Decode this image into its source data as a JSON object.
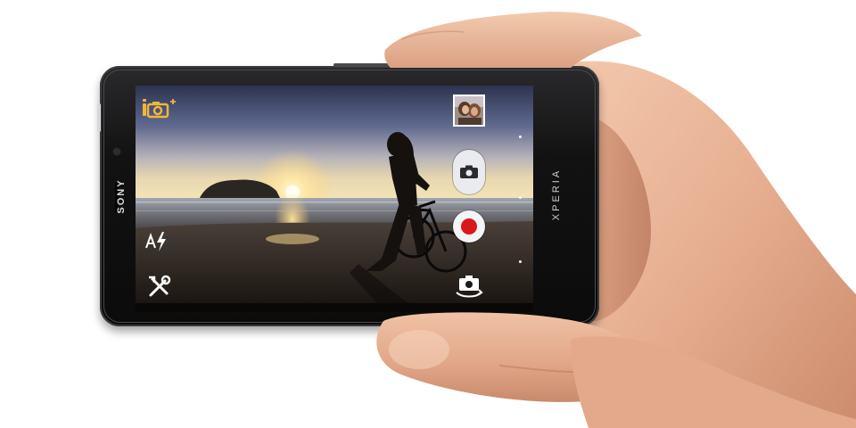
{
  "device": {
    "brand_left": "SONY",
    "brand_right": "XPERIA",
    "body_color": "#121213"
  },
  "camera_ui": {
    "mode_icon": "camera-mode-plus-icon",
    "flash_icon": "auto-flash-icon",
    "settings_icon": "settings-tools-icon",
    "thumbnail": "last-photo-thumbnail",
    "shutter_icon": "camera-shutter-icon",
    "record_icon": "video-record-icon",
    "switch_camera_icon": "switch-camera-icon",
    "accent_color": "#f2b53a",
    "record_color": "#d8181d"
  }
}
